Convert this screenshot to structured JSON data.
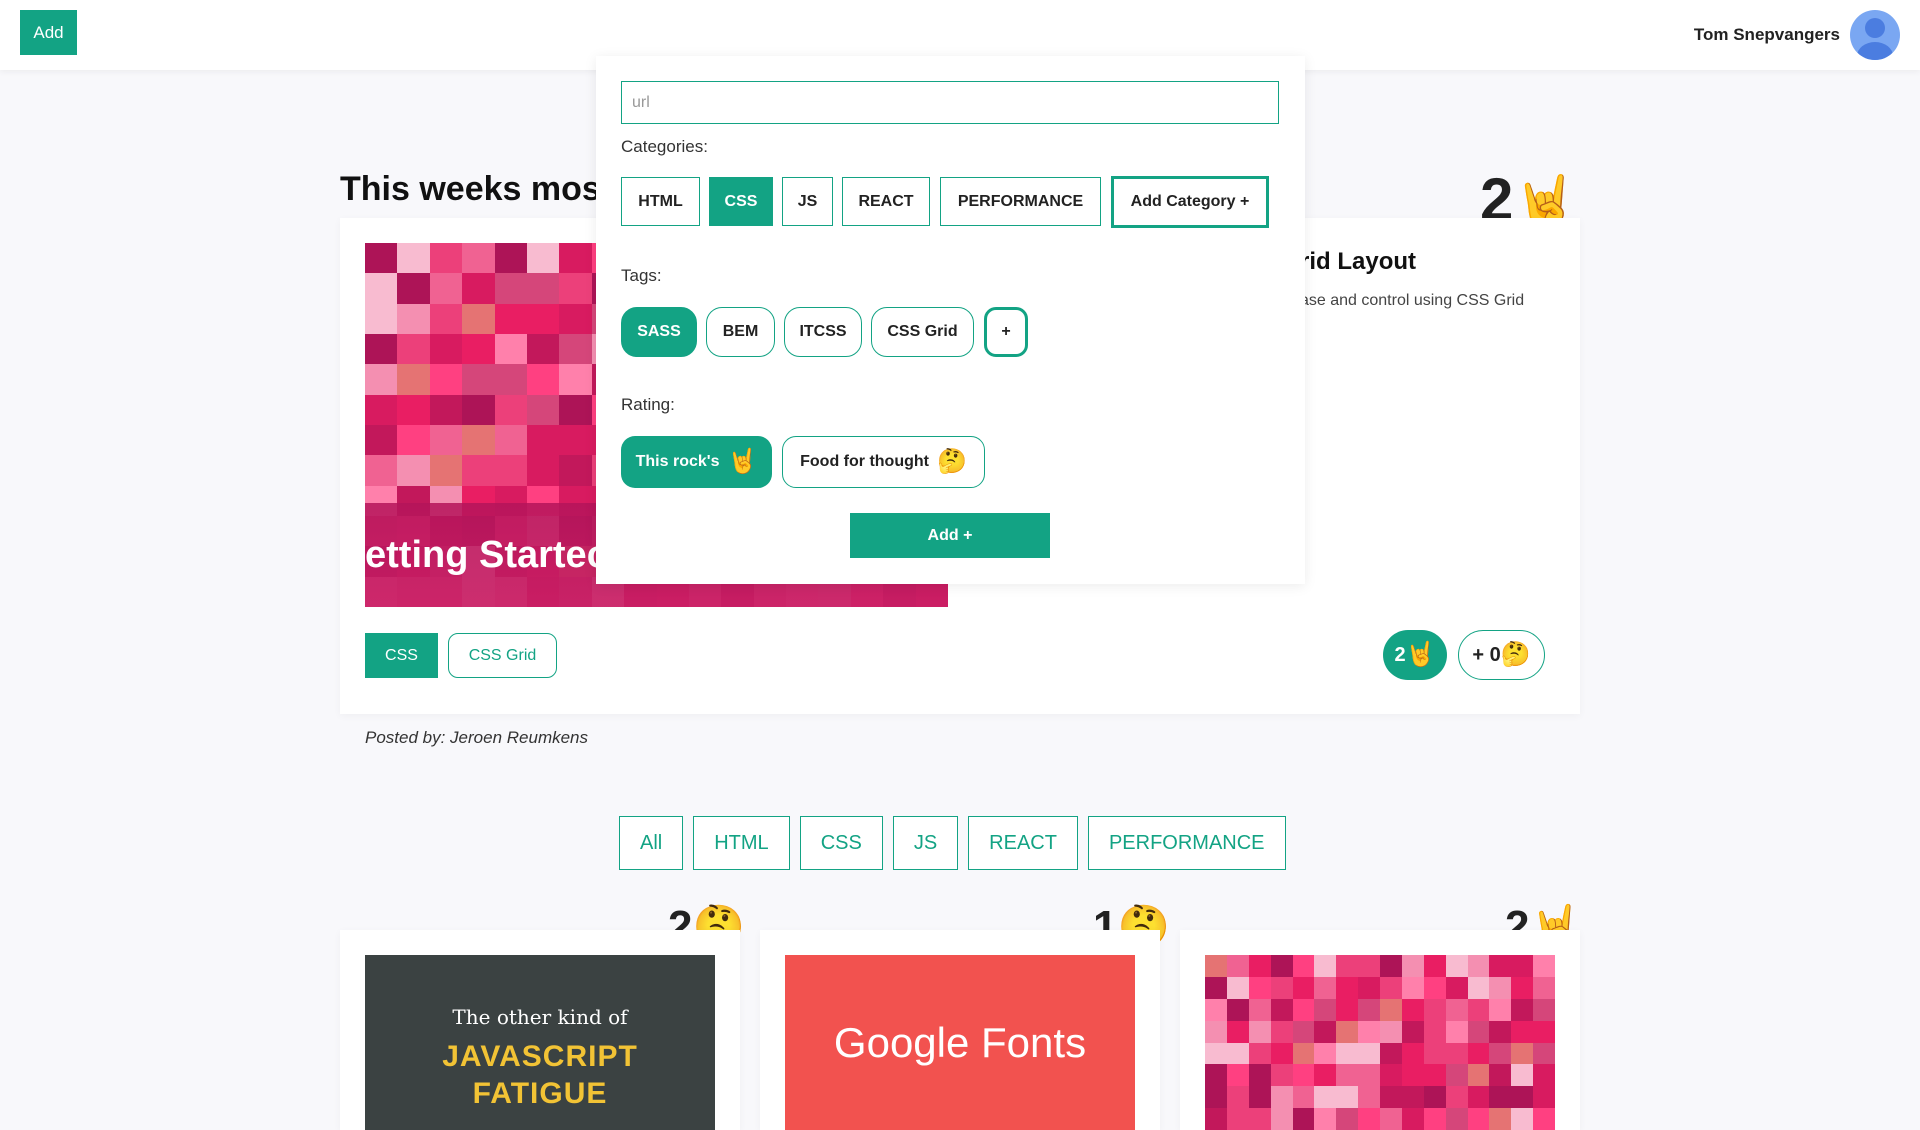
{
  "topbar": {
    "add_label": "Add",
    "user_name": "Tom Snepvangers"
  },
  "featured": {
    "section_title": "This weeks mos",
    "image_overlay_text": "etting Startec",
    "heading": "rid Layout",
    "description": "ase and control using CSS Grid",
    "score": "2",
    "score_icon": "🤘",
    "categories": [
      "CSS",
      "CSS Grid"
    ],
    "rock_count": "2",
    "rock_icon": "🤘",
    "thought_label": "+ 0",
    "thought_icon": "🤔",
    "posted_by": "Posted by: Jeroen Reumkens"
  },
  "filters": [
    "All",
    "HTML",
    "CSS",
    "JS",
    "REACT",
    "PERFORMANCE"
  ],
  "cards": [
    {
      "score": "2",
      "icon": "🤔",
      "thumb_lines": [
        "The other kind of",
        "JAVASCRIPT",
        "FATIGUE"
      ]
    },
    {
      "score": "1",
      "icon": "🤔",
      "thumb_text": "Google Fonts"
    },
    {
      "score": "2",
      "icon": "🤘"
    }
  ],
  "modal": {
    "url_placeholder": "url",
    "categories_label": "Categories:",
    "categories": [
      "HTML",
      "CSS",
      "JS",
      "REACT",
      "PERFORMANCE"
    ],
    "selected_category": "CSS",
    "add_category_label": "Add Category +",
    "tags_label": "Tags:",
    "tags": [
      "SASS",
      "BEM",
      "ITCSS",
      "CSS Grid"
    ],
    "selected_tag": "SASS",
    "add_tag_label": "+",
    "rating_label": "Rating:",
    "rating_rocks": "This rock's",
    "rating_rocks_icon": "🤘",
    "rating_thought": "Food for thought",
    "rating_thought_icon": "🤔",
    "submit_label": "Add +"
  },
  "colors": {
    "accent": "#13a384",
    "background": "#f8f8fb"
  }
}
